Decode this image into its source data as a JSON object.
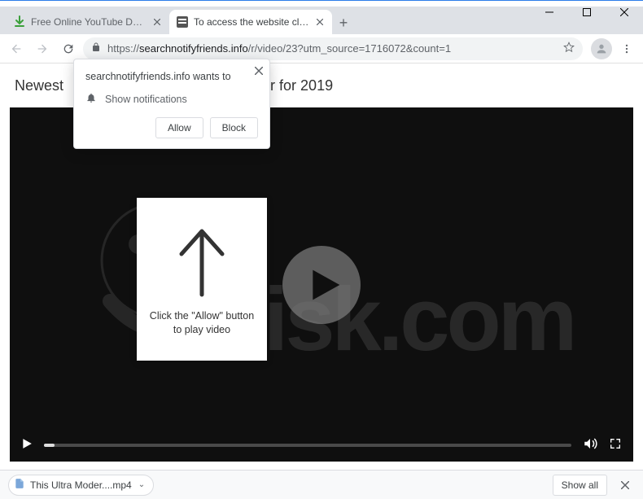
{
  "window": {
    "tabs": [
      {
        "title": "Free Online YouTube Downloade",
        "active": false
      },
      {
        "title": "To access the website click the \"A",
        "active": true
      }
    ]
  },
  "toolbar": {
    "url_protocol": "https://",
    "url_host": "searchnotifyfriends.info",
    "url_path": "/r/video/23?utm_source=1716072&count=1"
  },
  "page": {
    "nav_newest": "Newest",
    "title_fragment": "lar for 2019"
  },
  "overlay": {
    "message_line1": "Click the \"Allow\" button",
    "message_line2": "to play video"
  },
  "permission": {
    "wants_to": "searchnotifyfriends.info wants to",
    "show_notifications": "Show notifications",
    "allow": "Allow",
    "block": "Block"
  },
  "downloads": {
    "item": "This Ultra Moder....mp4",
    "show_all": "Show all"
  },
  "watermark": {
    "text": "risk.com"
  }
}
